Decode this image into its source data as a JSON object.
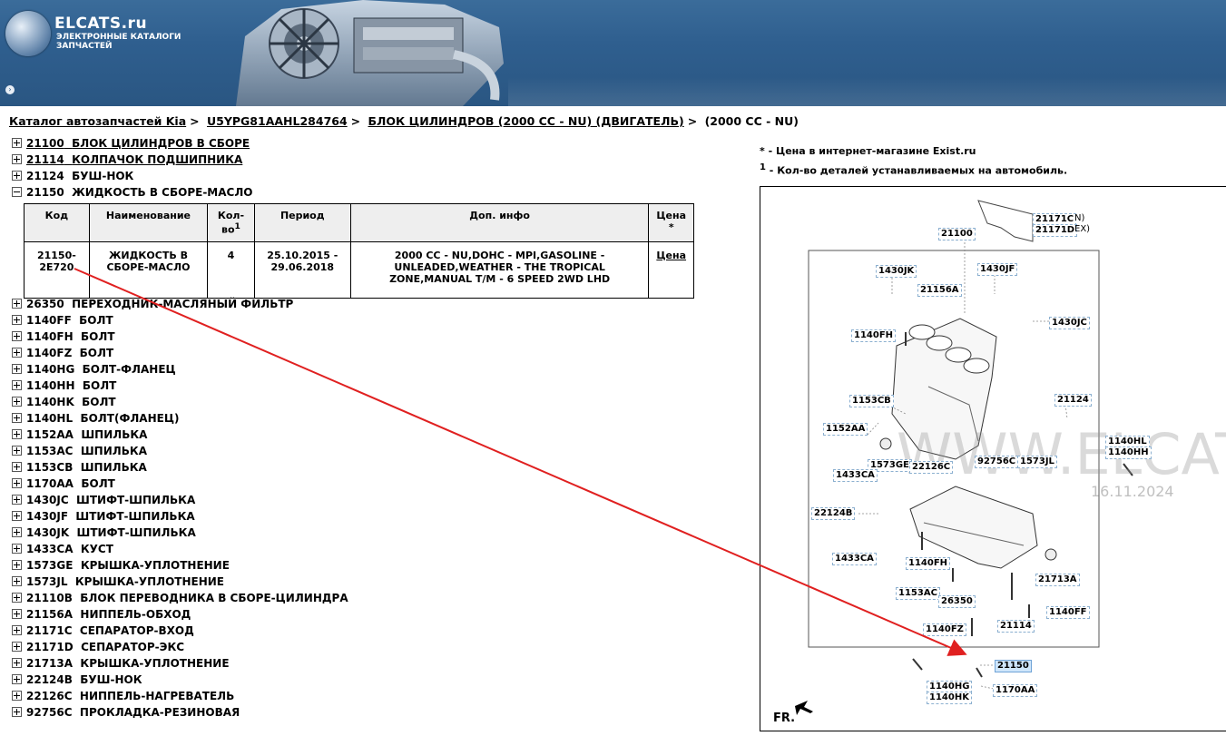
{
  "header": {
    "logo_title": "ELCATS.ru",
    "logo_sub1": "ЭЛЕКТРОННЫЕ КАТАЛОГИ",
    "logo_sub2": "ЗАПЧАСТЕЙ",
    "nav_icon": "›"
  },
  "breadcrumb": {
    "items": [
      "Каталог автозапчастей Kia",
      "U5YPG81AAHL284764",
      "БЛОК ЦИЛИНДРОВ (2000 CC - NU) (ДВИГАТЕЛЬ)"
    ],
    "current": "(2000 CC - NU)",
    "separator": ">"
  },
  "tree": {
    "expanded_before": [
      {
        "code": "21100",
        "name": "БЛОК ЦИЛИНДРОВ В СБОРЕ"
      },
      {
        "code": "21114",
        "name": "КОЛПАЧОК ПОДШИПНИКА"
      },
      {
        "code": "21124",
        "name": "БУШ-НОК"
      },
      {
        "code": "21150",
        "name": "ЖИДКОСТЬ В СБОРЕ-МАСЛО"
      }
    ],
    "after": [
      {
        "code": "26350",
        "name": "ПЕРЕХОДНИК-МАСЛЯНЫЙ ФИЛЬТР"
      },
      {
        "code": "1140FF",
        "name": "БОЛТ"
      },
      {
        "code": "1140FH",
        "name": "БОЛТ"
      },
      {
        "code": "1140FZ",
        "name": "БОЛТ"
      },
      {
        "code": "1140HG",
        "name": "БОЛТ-ФЛАНЕЦ"
      },
      {
        "code": "1140HH",
        "name": "БОЛТ"
      },
      {
        "code": "1140HK",
        "name": "БОЛТ"
      },
      {
        "code": "1140HL",
        "name": "БОЛТ(ФЛАНЕЦ)"
      },
      {
        "code": "1152AA",
        "name": "ШПИЛЬКА"
      },
      {
        "code": "1153AC",
        "name": "ШПИЛЬКА"
      },
      {
        "code": "1153CB",
        "name": "ШПИЛЬКА"
      },
      {
        "code": "1170AA",
        "name": "БОЛТ"
      },
      {
        "code": "1430JC",
        "name": "ШТИФТ-ШПИЛЬКА"
      },
      {
        "code": "1430JF",
        "name": "ШТИФТ-ШПИЛЬКА"
      },
      {
        "code": "1430JK",
        "name": "ШТИФТ-ШПИЛЬКА"
      },
      {
        "code": "1433CA",
        "name": "КУСТ"
      },
      {
        "code": "1573GE",
        "name": "КРЫШКА-УПЛОТНЕНИЕ"
      },
      {
        "code": "1573JL",
        "name": "КРЫШКА-УПЛОТНЕНИЕ"
      },
      {
        "code": "21110B",
        "name": "БЛОК ПЕРЕВОДНИКА В СБОРЕ-ЦИЛИНДРА"
      },
      {
        "code": "21156A",
        "name": "НИППЕЛЬ-ОБХОД"
      },
      {
        "code": "21171C",
        "name": "СЕПАРАТОР-ВХОД"
      },
      {
        "code": "21171D",
        "name": "СЕПАРАТОР-ЭКС"
      },
      {
        "code": "21713A",
        "name": "КРЫШКА-УПЛОТНЕНИЕ"
      },
      {
        "code": "22124B",
        "name": "БУШ-НОК"
      },
      {
        "code": "22126C",
        "name": "НИППЕЛЬ-НАГРЕВАТЕЛЬ"
      },
      {
        "code": "92756C",
        "name": "ПРОКЛАДКА-РЕЗИНОВАЯ"
      }
    ]
  },
  "table": {
    "headers": {
      "code": "Код",
      "name": "Наименование",
      "qty": "Кол-во",
      "qty_sup": "1",
      "period": "Период",
      "info": "Доп. инфо",
      "price": "Цена",
      "price_sup": "*"
    },
    "row": {
      "code": "21150-2E720",
      "name": "ЖИДКОСТЬ В СБОРЕ-МАСЛО",
      "qty": "4",
      "period": "25.10.2015 - 29.06.2018",
      "info": "2000 CC - NU,DOHC - MPI,GASOLINE - UNLEADED,WEATHER - THE TROPICAL ZONE,MANUAL T/M - 6 SPEED 2WD LHD",
      "price": "Цена"
    }
  },
  "notes": {
    "star_mark": "*",
    "star_text": " - Цена в интернет-магазине Exist.ru",
    "qty_mark": "1",
    "qty_text": " - Кол-во деталей устанавливаемых на автомобиль."
  },
  "diagram": {
    "watermark": "WWW.ELCATS",
    "watermark_date": "16.11.2024",
    "fr_label": "FR.",
    "callouts": {
      "c21171C": "21171C",
      "c21171C_tail": "N)",
      "c21171D": "21171D",
      "c21171D_tail": "EX)",
      "c21100": "21100",
      "c1430JK": "1430JK",
      "c1430JF": "1430JF",
      "c21156A": "21156A",
      "c1430JC": "1430JC",
      "c1140FH": "1140FH",
      "c1153CB": "1153CB",
      "c21124": "21124",
      "c1152AA": "1152AA",
      "c1140HL": "1140HL",
      "c1140HH": "1140HH",
      "c1573GE": "1573GE",
      "c22126C": "22126C",
      "c92756C": "92756C",
      "c1573JL": "1573JL",
      "c1433CA_top": "1433CA",
      "c22124B": "22124B",
      "c1433CA_low": "1433CA",
      "c1140FH_low": "1140FH",
      "c21713A": "21713A",
      "c1153AC": "1153AC",
      "c26350": "26350",
      "c1140FF": "1140FF",
      "c1140FZ": "1140FZ",
      "c21114": "21114",
      "c21150": "21150",
      "c1140HG": "1140HG",
      "c1140HK": "1140HK",
      "c1170AA": "1170AA"
    }
  },
  "colors": {
    "header_bg": "#2f5f8f",
    "arrow": "#e02020",
    "highlight": "#cfe6fb"
  }
}
